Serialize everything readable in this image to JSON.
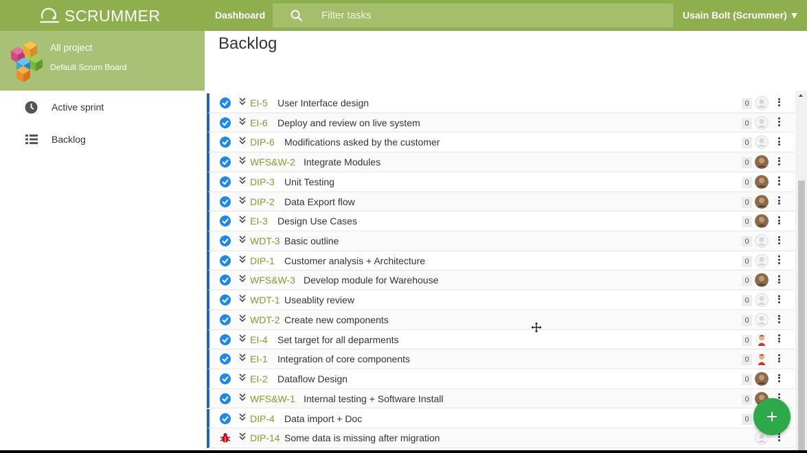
{
  "header": {
    "logo_text": "SCRUMMER",
    "nav_dashboard": "Dashboard",
    "search_placeholder": "Filter tasks",
    "user_menu": "Usain Bolt (Scrummer) ▼"
  },
  "sidebar": {
    "project_name": "All project",
    "board_name": "Default Scrum Board",
    "items": [
      {
        "label": "Active sprint",
        "icon": "clock-icon"
      },
      {
        "label": "Backlog",
        "icon": "list-icon"
      }
    ]
  },
  "main": {
    "title": "Backlog"
  },
  "tasks": [
    {
      "key": "EI-5",
      "title": "User Interface design",
      "points": "0",
      "avatar": "blank",
      "type": "task"
    },
    {
      "key": "EI-6",
      "title": "Deploy and review on live system",
      "points": "0",
      "avatar": "blank",
      "type": "task"
    },
    {
      "key": "DIP-6",
      "title": "Modifications asked by the customer",
      "points": "0",
      "avatar": "blank",
      "type": "task"
    },
    {
      "key": "WFS&W-2",
      "title": "Integrate Modules",
      "points": "0",
      "avatar": "brown",
      "type": "task"
    },
    {
      "key": "DIP-3",
      "title": "Unit Testing",
      "points": "0",
      "avatar": "brown",
      "type": "task"
    },
    {
      "key": "DIP-2",
      "title": "Data Export flow",
      "points": "0",
      "avatar": "brown",
      "type": "task"
    },
    {
      "key": "EI-3",
      "title": "Design Use Cases",
      "points": "0",
      "avatar": "brown",
      "type": "task"
    },
    {
      "key": "WDT-3",
      "title": "Basic outline",
      "points": "0",
      "avatar": "blank",
      "type": "task"
    },
    {
      "key": "DIP-1",
      "title": "Customer analysis + Architecture",
      "points": "0",
      "avatar": "blank",
      "type": "task"
    },
    {
      "key": "WFS&W-3",
      "title": "Develop module for Warehouse",
      "points": "0",
      "avatar": "brown",
      "type": "task"
    },
    {
      "key": "WDT-1",
      "title": "Useablity review",
      "points": "0",
      "avatar": "blank",
      "type": "task"
    },
    {
      "key": "WDT-2",
      "title": "Create new components",
      "points": "0",
      "avatar": "blank",
      "type": "task"
    },
    {
      "key": "EI-4",
      "title": "Set target for all deparments",
      "points": "0",
      "avatar": "red",
      "type": "task"
    },
    {
      "key": "EI-1",
      "title": "Integration of core components",
      "points": "0",
      "avatar": "red",
      "type": "task"
    },
    {
      "key": "EI-2",
      "title": "Dataflow Design",
      "points": "0",
      "avatar": "brown",
      "type": "task"
    },
    {
      "key": "WFS&W-1",
      "title": "Internal testing + Software Install",
      "points": "0",
      "avatar": "brown",
      "type": "task"
    },
    {
      "key": "DIP-4",
      "title": "Data import + Doc",
      "points": "0",
      "avatar": "brown",
      "type": "task"
    },
    {
      "key": "DIP-14",
      "title": "Some data is missing after migration",
      "points": "",
      "avatar": "blank",
      "type": "bug"
    }
  ],
  "colors": {
    "header": "#8fae4e",
    "accent_key": "#7aa22d",
    "row_border": "#2066b3",
    "check": "#1e88e5",
    "fab": "#2ea94a"
  }
}
